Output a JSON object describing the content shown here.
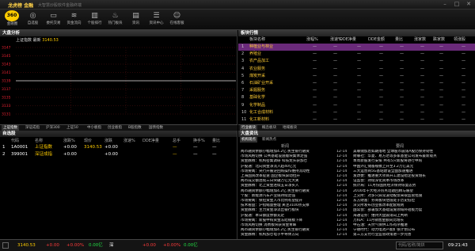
{
  "window": {
    "title": "龙虎榜 金融",
    "subtitle": "大智慧炒股软件金融终端",
    "min": "–",
    "max": "□",
    "close": "✕"
  },
  "toolbar": {
    "logo": "360",
    "buttons": [
      {
        "label": "金融圈",
        "icon": "home-icon",
        "glyph": "◉"
      },
      {
        "label": "自选股",
        "icon": "eye-icon",
        "glyph": "◎"
      },
      {
        "label": "委托交易",
        "icon": "wallet-icon",
        "glyph": "▭"
      },
      {
        "label": "资金流向",
        "icon": "flow-icon",
        "glyph": "≋"
      },
      {
        "label": "个股排行",
        "icon": "bars-icon",
        "glyph": "▥"
      },
      {
        "label": "热门板块",
        "icon": "flame-icon",
        "glyph": "♨"
      },
      {
        "label": "资讯",
        "icon": "news-icon",
        "glyph": "▤"
      },
      {
        "label": "资讯中心",
        "icon": "document-icon",
        "glyph": "☰"
      },
      {
        "label": "在线客服",
        "icon": "user-icon",
        "glyph": "☺"
      }
    ]
  },
  "chart_panel": {
    "title": "大盘分析",
    "info_name": "上证指数 最新",
    "info_value": "3140.53",
    "y_ticks": [
      "3147",
      "3145",
      "3143",
      "3141",
      "3139",
      "3137",
      "3135",
      "3133",
      "3131"
    ],
    "tabs": [
      "上证指数",
      "深证成指",
      "沪深300",
      "上证50",
      "中小板指",
      "创业板指",
      "B股指数",
      "国债指数"
    ]
  },
  "chart_data": {
    "type": "line",
    "title": "上证指数",
    "ylim": [
      3131,
      3147
    ],
    "y_ticks": [
      3147,
      3145,
      3143,
      3141,
      3139,
      3137,
      3135,
      3133,
      3131
    ],
    "series": [
      {
        "name": "上证指数",
        "values": []
      }
    ],
    "grid": true
  },
  "watchlist": {
    "title": "自选股",
    "columns": [
      "代码",
      "名称",
      "涨跌%",
      "现价",
      "涨跌",
      "涨速%",
      "DDE净量",
      "总手",
      "换手%",
      "量比"
    ],
    "rows": [
      {
        "idx": "1",
        "code": "1A0001",
        "name": "上证指数",
        "pct": "+0.00",
        "price": "3140.53",
        "chg": "+0.00",
        "speed": "",
        "dde": "",
        "vol": "—",
        "turn": "—",
        "ratio": "—"
      },
      {
        "idx": "2",
        "code": "399001",
        "name": "深证成指",
        "pct": "+0.00",
        "price": "",
        "chg": "+0.00",
        "speed": "",
        "dde": "",
        "vol": "—",
        "turn": "—",
        "ratio": "—"
      }
    ]
  },
  "sectors": {
    "title": "板块行情",
    "columns": [
      "板块名称",
      "涨幅%",
      "涨速%",
      "DDE净量",
      "DDE金额",
      "量比",
      "涨家数",
      "跌家数",
      "领涨股"
    ],
    "rows": [
      {
        "idx": "1",
        "name": "种植业与林业"
      },
      {
        "idx": "2",
        "name": "养殖业"
      },
      {
        "idx": "3",
        "name": "农产品加工"
      },
      {
        "idx": "4",
        "name": "农业服务"
      },
      {
        "idx": "5",
        "name": "煤炭开采"
      },
      {
        "idx": "6",
        "name": "石油矿业开采"
      },
      {
        "idx": "7",
        "name": "采掘服务"
      },
      {
        "idx": "8",
        "name": "基础化学"
      },
      {
        "idx": "9",
        "name": "化学制品"
      },
      {
        "idx": "10",
        "name": "化工合成材料"
      },
      {
        "idx": "11",
        "name": "化工新材料"
      }
    ],
    "placeholder": "—",
    "tabs": [
      "行业板块",
      "概念板块",
      "地域板块"
    ]
  },
  "news": {
    "title": "大盘资讯",
    "tabs": [
      "机构观点",
      "新闻热点"
    ],
    "col_left": "新闻",
    "col_right": "要闻",
    "rows": [
      {
        "t1": "两市融资余额小幅增加4.2亿 民生银行融资",
        "time": "12-14",
        "t2": "美联储加息如期落地 全球股市震荡A股仍保持韧性"
      },
      {
        "t1": "市场风格切换 公共基础设施版块集体走强",
        "time": "12-14",
        "t2": "财联社：华夏、易方达等多家基金公司发布最新观点"
      },
      {
        "t1": "资金脉搏：机构密集调研 科技龙头获加仓",
        "time": "12-14",
        "t2": "本周新股发行安排 共有5只新股将进行申购"
      },
      {
        "t1": "沪股通：北向资金净流入超40亿元",
        "time": "12-14",
        "t2": "中国外汇储备规模上升至3.2万亿美元"
      },
      {
        "t1": "市场要闻：央行开展逆回购操作维持流动性",
        "time": "12-14",
        "t2": "三大运营商5G基站建设全面加速推进"
      },
      {
        "t1": "上海国资改革提速 国企板块异动拉升",
        "time": "12-14",
        "t2": "发改委：推进重大项目开工建设稳定投资增长"
      },
      {
        "t1": "两市成交额连续三日突破万亿元大关",
        "time": "12-14",
        "t2": "证监会：持续深化资本市场改革"
      },
      {
        "t1": "资金脉搏：北上资金连续五日净买入",
        "time": "12-14",
        "t2": "统计局：11月份国民经济保持恢复态势"
      },
      {
        "t1": "两市融资余额小幅增加4.2亿 民生银行融资",
        "time": "12-14",
        "t2": "2016年十大经济热点话题回顾与展望"
      },
      {
        "t1": "个股：新能源汽车产业链持续走强",
        "time": "12-14",
        "t2": "上交所：对多只异常波动股票采取监管措施"
      },
      {
        "t1": "市场要闻：保险资金入市比例有望提升",
        "time": "12-14",
        "t2": "东方财富：券商板块估值处于历史低位"
      },
      {
        "t1": "技术看盘：沪指缩量整理 关注3100点支撑",
        "time": "12-14",
        "t2": "深交所发布创业板改革配套规则"
      },
      {
        "t1": "资金脉搏：主力资金净流出银行板块",
        "time": "12-14",
        "t2": "国常会：部署加大基础设施领域补短板力度"
      },
      {
        "t1": "沪股通：本日额度余额充足",
        "time": "12-14",
        "t2": "海通证券：维持大盘震荡向上判断"
      },
      {
        "t1": "市场要闻：新股申购资金冻结规模下降",
        "time": "12-14",
        "t2": "万科A：11月销售金额同比增长"
      },
      {
        "t1": "市场风格切换 消费板块获资金青睐",
        "time": "12-14",
        "t2": "中石油：天然气保供工作有序推进"
      },
      {
        "t1": "两市融资余额小幅增加4.2亿 民生银行融资",
        "time": "12-14",
        "t2": "宁德时代：动力电池产能扩张计划公布"
      },
      {
        "t1": "资金脉搏：机构加仓电子半导体方向",
        "time": "12-14",
        "t2": "第三方支付行业监管政策进一步完善"
      }
    ]
  },
  "status": {
    "sh_val": "3140.53",
    "sh_chg": "+0.00",
    "sh_pct": "+0.00%",
    "sh_amt": "0.00亿",
    "sz_label": "深",
    "sz_chg": "+0.00",
    "sz_pct": "+0.00%",
    "sz_amt": "0.00亿",
    "search_placeholder": "代码/名称/简拼",
    "clock": "09:21:43"
  }
}
